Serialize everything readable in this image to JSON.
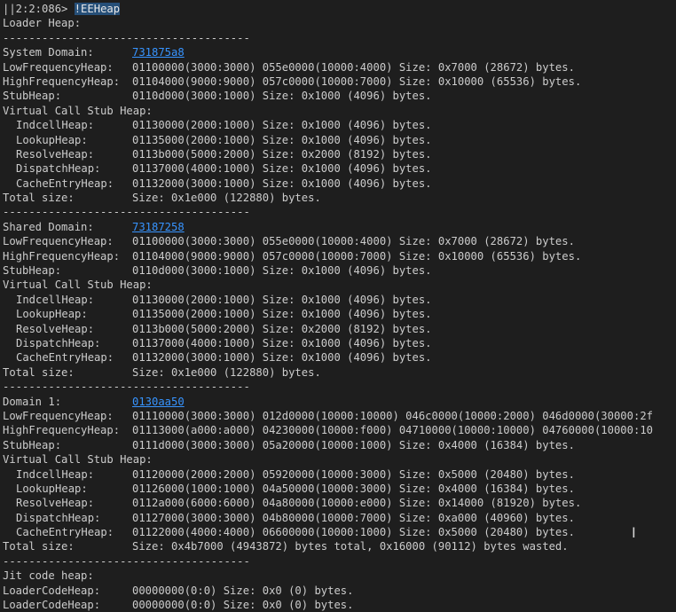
{
  "prompt": "||2:2:086> ",
  "command": "!EEHeap",
  "loader_heap_title": "Loader Heap:",
  "separator": "--------------------------------------",
  "system_domain": {
    "label": "System Domain:",
    "address": "731875a8",
    "low": [
      "LowFrequencyHeap:",
      "01100000(3000:3000) 055e0000(10000:4000) Size: 0x7000 (28672) bytes."
    ],
    "high": [
      "HighFrequencyHeap:",
      "01104000(9000:9000) 057c0000(10000:7000) Size: 0x10000 (65536) bytes."
    ],
    "stub": [
      "StubHeap:",
      "0110d000(3000:1000) Size: 0x1000 (4096) bytes."
    ],
    "vcs_title": "Virtual Call Stub Heap:",
    "vcs": [
      [
        "IndcellHeap:",
        "01130000(2000:1000) Size: 0x1000 (4096) bytes."
      ],
      [
        "LookupHeap:",
        "01135000(2000:1000) Size: 0x1000 (4096) bytes."
      ],
      [
        "ResolveHeap:",
        "0113b000(5000:2000) Size: 0x2000 (8192) bytes."
      ],
      [
        "DispatchHeap:",
        "01137000(4000:1000) Size: 0x1000 (4096) bytes."
      ],
      [
        "CacheEntryHeap:",
        "01132000(3000:1000) Size: 0x1000 (4096) bytes."
      ]
    ],
    "total": [
      "Total size:",
      "Size: 0x1e000 (122880) bytes."
    ]
  },
  "shared_domain": {
    "label": "Shared Domain:",
    "address": "73187258",
    "low": [
      "LowFrequencyHeap:",
      "01100000(3000:3000) 055e0000(10000:4000) Size: 0x7000 (28672) bytes."
    ],
    "high": [
      "HighFrequencyHeap:",
      "01104000(9000:9000) 057c0000(10000:7000) Size: 0x10000 (65536) bytes."
    ],
    "stub": [
      "StubHeap:",
      "0110d000(3000:1000) Size: 0x1000 (4096) bytes."
    ],
    "vcs_title": "Virtual Call Stub Heap:",
    "vcs": [
      [
        "IndcellHeap:",
        "01130000(2000:1000) Size: 0x1000 (4096) bytes."
      ],
      [
        "LookupHeap:",
        "01135000(2000:1000) Size: 0x1000 (4096) bytes."
      ],
      [
        "ResolveHeap:",
        "0113b000(5000:2000) Size: 0x2000 (8192) bytes."
      ],
      [
        "DispatchHeap:",
        "01137000(4000:1000) Size: 0x1000 (4096) bytes."
      ],
      [
        "CacheEntryHeap:",
        "01132000(3000:1000) Size: 0x1000 (4096) bytes."
      ]
    ],
    "total": [
      "Total size:",
      "Size: 0x1e000 (122880) bytes."
    ]
  },
  "domain1": {
    "label": "Domain 1:",
    "address": "0130aa50",
    "low": [
      "LowFrequencyHeap:",
      "01110000(3000:3000) 012d0000(10000:10000) 046c0000(10000:2000) 046d0000(30000:2f"
    ],
    "high": [
      "HighFrequencyHeap:",
      "01113000(a000:a000) 04230000(10000:f000) 04710000(10000:10000) 04760000(10000:10"
    ],
    "stub": [
      "StubHeap:",
      "0111d000(3000:3000) 05a20000(10000:1000) Size: 0x4000 (16384) bytes."
    ],
    "vcs_title": "Virtual Call Stub Heap:",
    "vcs": [
      [
        "IndcellHeap:",
        "01120000(2000:2000) 05920000(10000:3000) Size: 0x5000 (20480) bytes."
      ],
      [
        "LookupHeap:",
        "01126000(1000:1000) 04a50000(10000:3000) Size: 0x4000 (16384) bytes."
      ],
      [
        "ResolveHeap:",
        "0112a000(6000:6000) 04a80000(10000:e000) Size: 0x14000 (81920) bytes."
      ],
      [
        "DispatchHeap:",
        "01127000(3000:3000) 04b80000(10000:7000) Size: 0xa000 (40960) bytes."
      ],
      [
        "CacheEntryHeap:",
        "01122000(4000:4000) 06600000(10000:1000) Size: 0x5000 (20480) bytes."
      ]
    ],
    "total": [
      "Total size:",
      "Size: 0x4b7000 (4943872) bytes total, 0x16000 (90112) bytes wasted."
    ]
  },
  "jit": {
    "title": "Jit code heap:",
    "rows": [
      [
        "LoaderCodeHeap:",
        "00000000(0:0) Size: 0x0 (0) bytes."
      ],
      [
        "LoaderCodeHeap:",
        "00000000(0:0) Size: 0x0 (0) bytes."
      ]
    ]
  },
  "cursor_icon": "text-cursor-icon"
}
